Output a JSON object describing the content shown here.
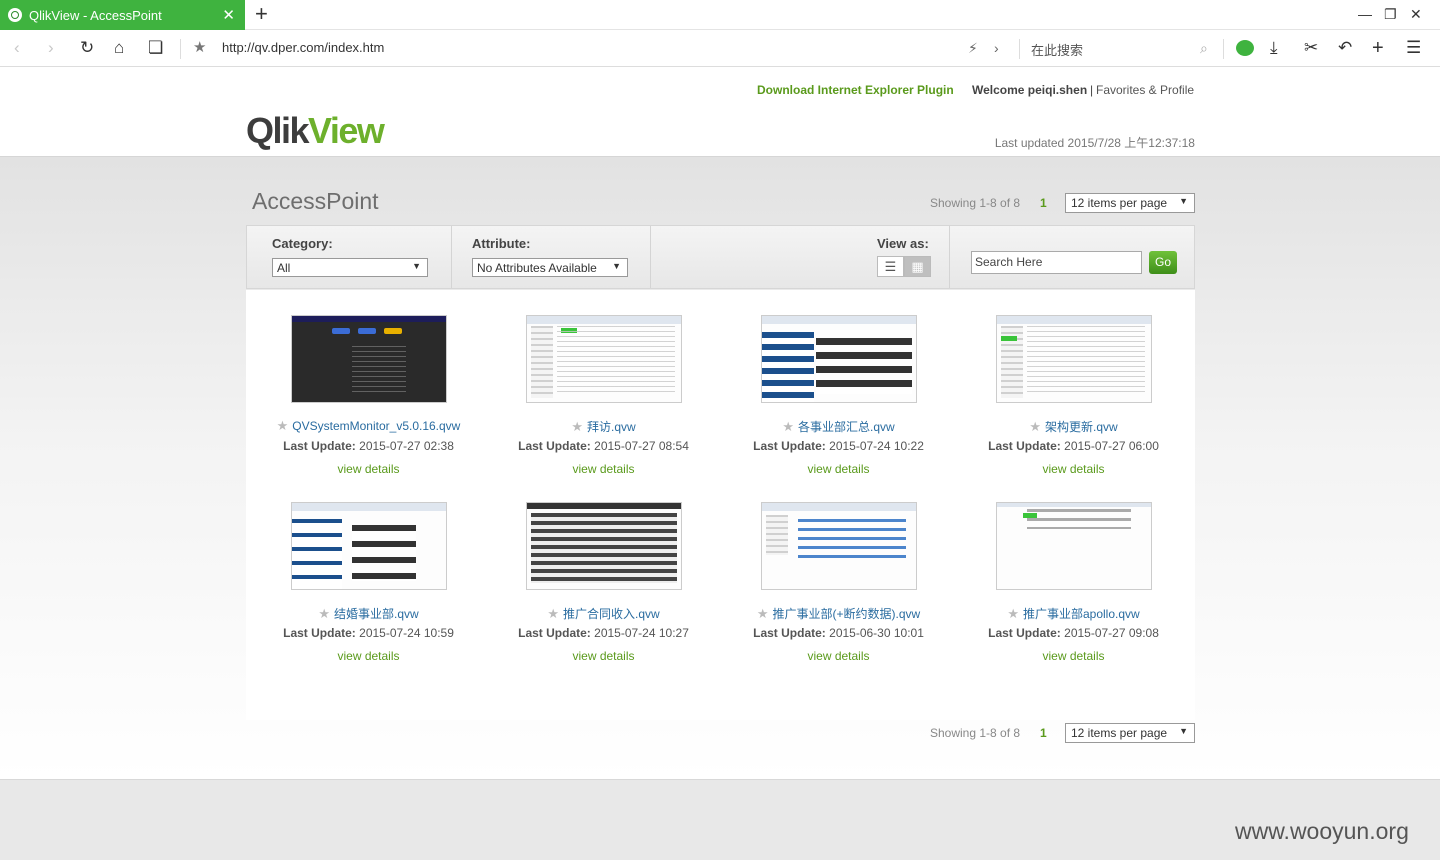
{
  "browser": {
    "tab_title": "QlikView - AccessPoint",
    "url": "http://qv.dper.com/index.htm",
    "search_placeholder": "在此搜索"
  },
  "header": {
    "plugin_link": "Download Internet Explorer Plugin",
    "welcome": "Welcome peiqi.shen",
    "separator": "|",
    "favorites": "Favorites & Profile",
    "logo_qlik": "Qlik",
    "logo_view": "View",
    "last_updated": "Last updated 2015/7/28 上午12:37:18"
  },
  "accesspoint": {
    "title": "AccessPoint",
    "showing": "Showing 1-8 of 8",
    "page": "1",
    "per_page": "12 items per page"
  },
  "filters": {
    "category_label": "Category:",
    "category_value": "All",
    "attribute_label": "Attribute:",
    "attribute_value": "No Attributes Available",
    "viewas_label": "View as:",
    "search_placeholder": "Search Here",
    "go_label": "Go"
  },
  "documents": [
    {
      "name": "QVSystemMonitor_v5.0.16.qvw",
      "last_update_label": "Last Update:",
      "date": "2015-07-27 02:38",
      "details": "view details"
    },
    {
      "name": "拜访.qvw",
      "last_update_label": "Last Update:",
      "date": "2015-07-27 08:54",
      "details": "view details"
    },
    {
      "name": "各事业部汇总.qvw",
      "last_update_label": "Last Update:",
      "date": "2015-07-24 10:22",
      "details": "view details"
    },
    {
      "name": "架构更新.qvw",
      "last_update_label": "Last Update:",
      "date": "2015-07-27 06:00",
      "details": "view details"
    },
    {
      "name": "结婚事业部.qvw",
      "last_update_label": "Last Update:",
      "date": "2015-07-24 10:59",
      "details": "view details"
    },
    {
      "name": "推广合同收入.qvw",
      "last_update_label": "Last Update:",
      "date": "2015-07-24 10:27",
      "details": "view details"
    },
    {
      "name": "推广事业部(+断约数据).qvw",
      "last_update_label": "Last Update:",
      "date": "2015-06-30 10:01",
      "details": "view details"
    },
    {
      "name": "推广事业部apollo.qvw",
      "last_update_label": "Last Update:",
      "date": "2015-07-27 09:08",
      "details": "view details"
    }
  ],
  "watermark": "www.wooyun.org",
  "colors": {
    "tab_green": "#3fb33f",
    "link_green": "#5a9a1c",
    "link_blue": "#2a6ca0"
  }
}
